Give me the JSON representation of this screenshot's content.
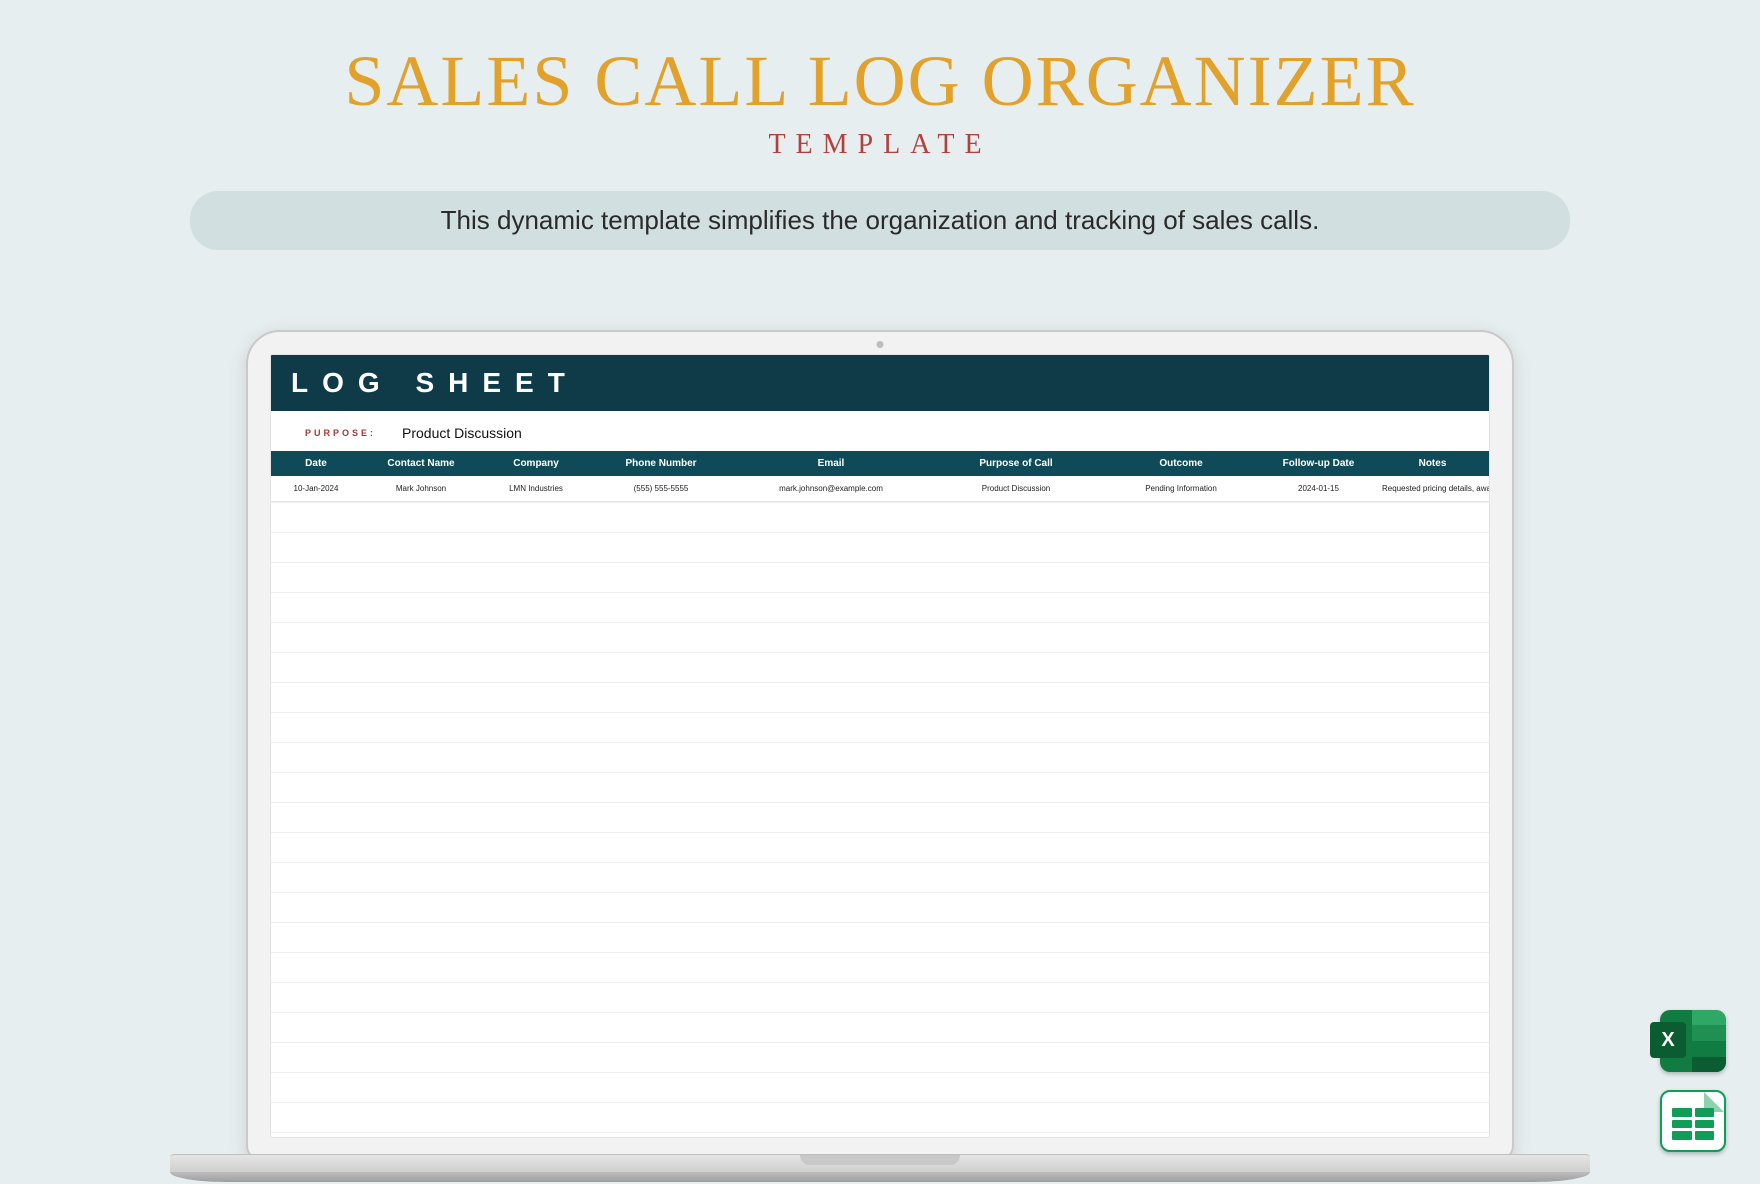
{
  "header": {
    "title": "SALES CALL LOG ORGANIZER",
    "subtitle": "TEMPLATE",
    "description": "This dynamic template simplifies the organization and tracking of sales calls."
  },
  "sheet": {
    "banner": "LOG SHEET",
    "purpose_label": "PURPOSE:",
    "purpose_value": "Product Discussion",
    "columns": [
      "Date",
      "Contact Name",
      "Company",
      "Phone Number",
      "Email",
      "Purpose of Call",
      "Outcome",
      "Follow-up Date",
      "Notes"
    ],
    "rows": [
      {
        "date": "10-Jan-2024",
        "contact": "Mark Johnson",
        "company": "LMN Industries",
        "phone": "(555) 555-5555",
        "email": "mark.johnson@example.com",
        "purpose": "Product Discussion",
        "outcome": "Pending Information",
        "followup": "2024-01-15",
        "notes": "Requested pricing details, awaiting response."
      }
    ]
  },
  "icons": {
    "excel_letter": "X"
  }
}
